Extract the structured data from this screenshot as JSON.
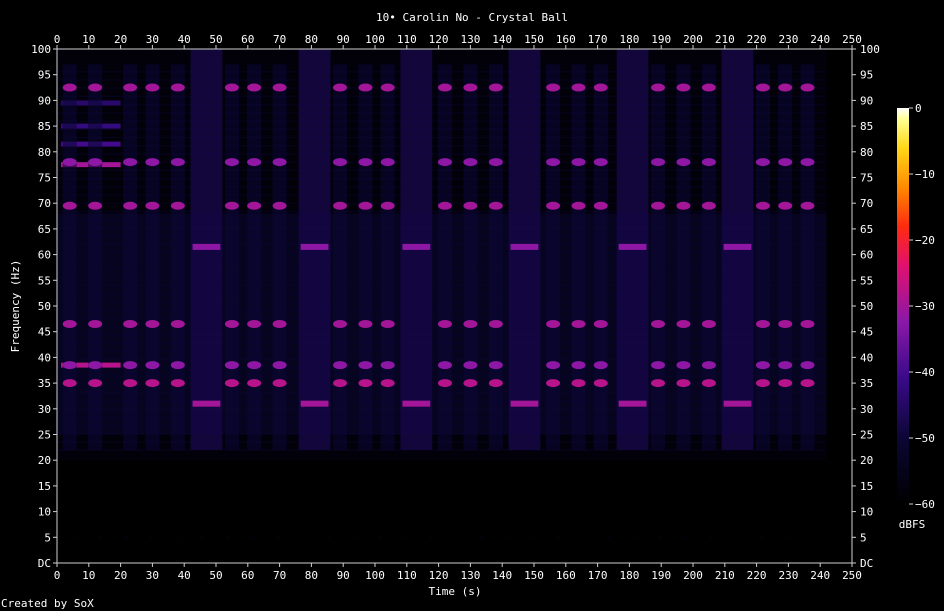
{
  "title": "10• Carolin No - Crystal Ball",
  "credit": "Created by SoX",
  "colors": {
    "background": "#000000",
    "axis": "#ffffff",
    "low": "#000000",
    "high": "#ffffff"
  },
  "chart_data": {
    "type": "heatmap",
    "title": "10• Carolin No - Crystal Ball",
    "xlabel": "Time (s)",
    "ylabel": "Frequency (Hz)",
    "xlim": [
      0,
      250
    ],
    "ylim": [
      0,
      100
    ],
    "x_ticks": [
      "0",
      "10",
      "20",
      "30",
      "40",
      "50",
      "60",
      "70",
      "80",
      "90",
      "100",
      "110",
      "120",
      "130",
      "140",
      "150",
      "160",
      "170",
      "180",
      "190",
      "200",
      "210",
      "220",
      "230",
      "240",
      "250"
    ],
    "y_ticks": [
      "DC",
      "5",
      "10",
      "15",
      "20",
      "25",
      "30",
      "35",
      "40",
      "45",
      "50",
      "55",
      "60",
      "65",
      "70",
      "75",
      "80",
      "85",
      "90",
      "95",
      "100"
    ],
    "audio_end_s": 242,
    "colorbar": {
      "label": "dBFS",
      "ticks": [
        0,
        -10,
        -20,
        -30,
        -40,
        -50,
        -60
      ],
      "tick_labels": [
        "0",
        "−10",
        "−20",
        "−30",
        "−40",
        "−50",
        "−60"
      ],
      "range": [
        -60,
        0
      ]
    },
    "intro": {
      "t_end": 20,
      "bands": [
        {
          "freq": 38.5,
          "db": -28
        },
        {
          "freq": 77.5,
          "db": -30
        },
        {
          "freq": 81.5,
          "db": -40
        },
        {
          "freq": 85,
          "db": -42
        },
        {
          "freq": 89.5,
          "db": -44
        }
      ]
    },
    "beat_freqs": [
      {
        "freq": 92.5,
        "db": -30
      },
      {
        "freq": 78,
        "db": -32
      },
      {
        "freq": 69.5,
        "db": -30
      },
      {
        "freq": 46.5,
        "db": -30
      },
      {
        "freq": 38.5,
        "db": -32
      },
      {
        "freq": 35,
        "db": -28
      }
    ],
    "low_blocks": [
      {
        "t": 47,
        "freq_low": 31,
        "freq_high": 61.5
      },
      {
        "t": 81,
        "freq_low": 31,
        "freq_high": 61.5
      },
      {
        "t": 113,
        "freq_low": 31,
        "freq_high": 61.5
      },
      {
        "t": 147,
        "freq_low": 31,
        "freq_high": 61.5
      },
      {
        "t": 181,
        "freq_low": 31,
        "freq_high": 61.5
      },
      {
        "t": 214,
        "freq_low": 31,
        "freq_high": 61.5
      }
    ],
    "beat_times": [
      4,
      12,
      23,
      30,
      38,
      55,
      62,
      70,
      89,
      97,
      104,
      122,
      130,
      138,
      156,
      164,
      171,
      189,
      197,
      205,
      222,
      229,
      236
    ]
  }
}
